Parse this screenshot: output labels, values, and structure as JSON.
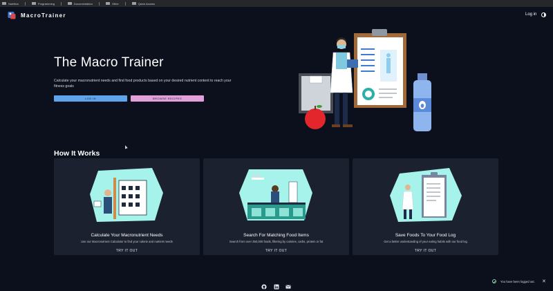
{
  "bookmarks": [
    {
      "label": "Nutrition",
      "icon": "folder-icon"
    },
    {
      "label": "Programming",
      "icon": "folder-icon"
    },
    {
      "label": "Documentation",
      "icon": "folder-icon"
    },
    {
      "label": "Other",
      "icon": "folder-icon"
    },
    {
      "label": "Quick Access",
      "icon": "folder-icon"
    }
  ],
  "header": {
    "brand": "MacroTrainer",
    "login_label": "Log in",
    "theme_icon": "theme-toggle-icon"
  },
  "hero": {
    "title": "The Macro Trainer",
    "description": "Calculate your macronutrient needs and find food products based on your desired nutrient content to reach your fitness goals",
    "login_button": "LOG IN",
    "browse_button": "BROWSE RECIPES",
    "illustration": "doctor-clipboard-illustration"
  },
  "how": {
    "title": "How It Works",
    "cards": [
      {
        "title": "Calculate Your Macronutrient Needs",
        "desc": "Use our Macronutrient Calculator to find your calorie and nutrient needs",
        "cta": "TRY IT OUT",
        "art": "calculator-illustration"
      },
      {
        "title": "Search For Matching Food Items",
        "desc": "Search from over 350,000 foods, filtering by calories, carbs, protein or fat",
        "cta": "TRY IT OUT",
        "art": "kitchen-illustration"
      },
      {
        "title": "Save Foods To Your Food Log",
        "desc": "Get a better understanding of your eating habits with our food log",
        "cta": "TRY IT OUT",
        "art": "food-log-illustration"
      }
    ]
  },
  "footer": {
    "icons": [
      "github-icon",
      "linkedin-icon",
      "mail-icon"
    ]
  },
  "toast": {
    "message": "You have been logged out.",
    "close": "✕"
  },
  "colors": {
    "background": "#0b101c",
    "card": "#1c2130",
    "primary_button": "#5fa4ea",
    "secondary_button": "#e1a0d9",
    "illustration_accent": "#a5f3ea"
  }
}
